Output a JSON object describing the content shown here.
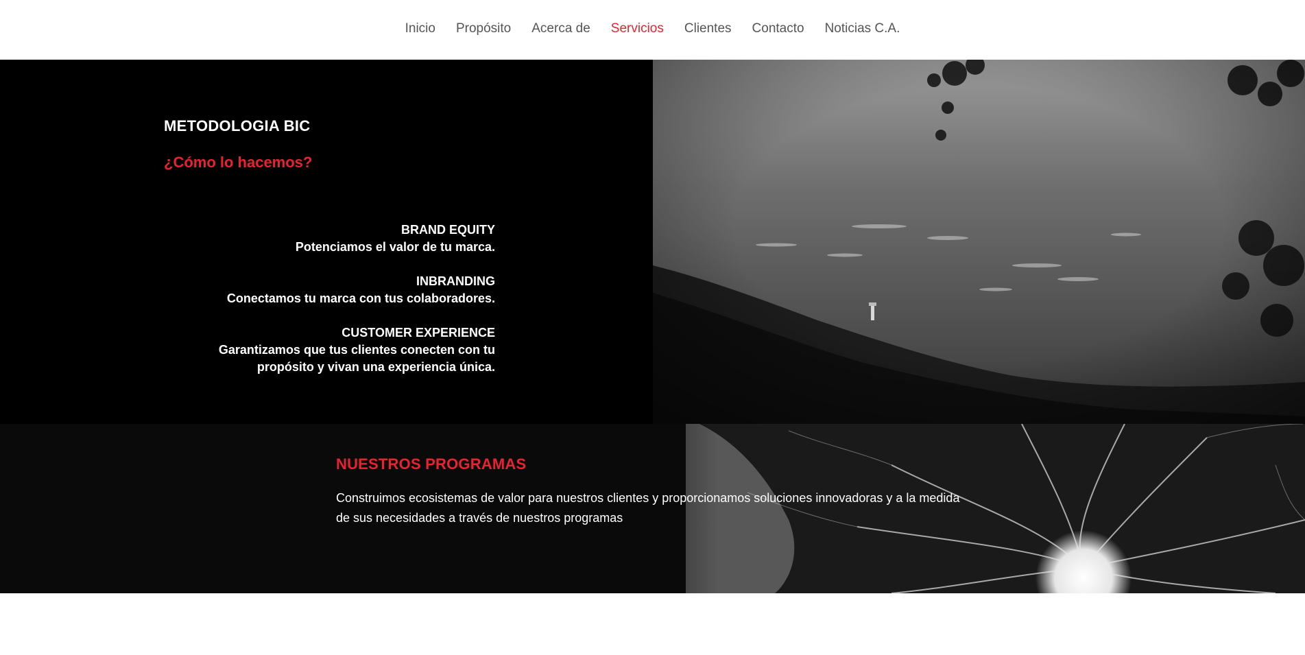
{
  "nav": {
    "items": [
      {
        "label": "Inicio"
      },
      {
        "label": "Propósito"
      },
      {
        "label": "Acerca de"
      },
      {
        "label": "Servicios"
      },
      {
        "label": "Clientes"
      },
      {
        "label": "Contacto"
      },
      {
        "label": "Noticias C.A."
      }
    ],
    "active": "Servicios"
  },
  "metodologia": {
    "title": "METODOLOGIA BIC",
    "subtitle": "¿Cómo lo hacemos?",
    "services": [
      {
        "head": "BRAND EQUITY",
        "desc": "Potenciamos el valor de tu marca."
      },
      {
        "head": "INBRANDING",
        "desc": "Conectamos tu marca con tus colaboradores."
      },
      {
        "head": "CUSTOMER EXPERIENCE",
        "desc": "Garantizamos que tus clientes conecten con tu propósito y vivan una experiencia única."
      }
    ]
  },
  "programas": {
    "title": "NUESTROS PROGRAMAS",
    "text": "Construimos ecosistemas de valor para nuestros clientes y proporcionamos soluciones innovadoras y a la medida de sus necesidades a través de nuestros programas"
  },
  "colors": {
    "accent": "#e8232f",
    "nav_text": "#555555",
    "dark_bg": "#000000"
  }
}
